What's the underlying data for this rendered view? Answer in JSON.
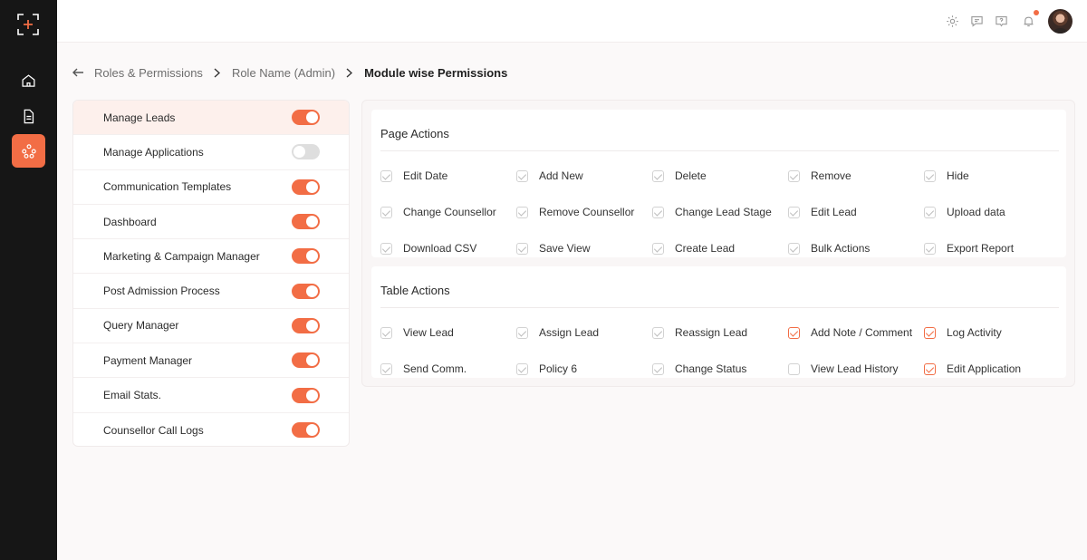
{
  "breadcrumb": {
    "items": [
      "Roles & Permissions",
      "Role Name (Admin)"
    ],
    "current": "Module wise Permissions"
  },
  "modules": [
    {
      "label": "Manage Leads",
      "enabled": true,
      "active": true
    },
    {
      "label": "Manage Applications",
      "enabled": false
    },
    {
      "label": "Communication Templates",
      "enabled": true
    },
    {
      "label": "Dashboard",
      "enabled": true
    },
    {
      "label": "Marketing & Campaign Manager",
      "enabled": true
    },
    {
      "label": "Post Admission Process",
      "enabled": true
    },
    {
      "label": "Query Manager",
      "enabled": true
    },
    {
      "label": "Payment Manager",
      "enabled": true
    },
    {
      "label": "Email Stats.",
      "enabled": true
    },
    {
      "label": "Counsellor Call Logs",
      "enabled": true
    }
  ],
  "page_actions": {
    "title": "Page Actions",
    "items": [
      {
        "label": "Edit Date",
        "checked": true
      },
      {
        "label": "Add New",
        "checked": true
      },
      {
        "label": "Delete",
        "checked": true
      },
      {
        "label": "Remove",
        "checked": true
      },
      {
        "label": "Hide",
        "checked": true
      },
      {
        "label": "Change Counsellor",
        "checked": true
      },
      {
        "label": "Remove Counsellor",
        "checked": true
      },
      {
        "label": "Change Lead Stage",
        "checked": true
      },
      {
        "label": "Edit Lead",
        "checked": true
      },
      {
        "label": "Upload data",
        "checked": true
      },
      {
        "label": "Download CSV",
        "checked": true
      },
      {
        "label": "Save View",
        "checked": true
      },
      {
        "label": "Create Lead",
        "checked": true
      },
      {
        "label": "Bulk Actions",
        "checked": true
      },
      {
        "label": "Export Report",
        "checked": true
      }
    ]
  },
  "table_actions": {
    "title": "Table Actions",
    "items": [
      {
        "label": "View Lead",
        "checked": true
      },
      {
        "label": "Assign Lead",
        "checked": true
      },
      {
        "label": "Reassign Lead",
        "checked": true
      },
      {
        "label": "Add Note / Comment",
        "checked": true,
        "accent": true
      },
      {
        "label": "Log Activity",
        "checked": true,
        "accent": true
      },
      {
        "label": "Send Comm.",
        "checked": true
      },
      {
        "label": "Policy 6",
        "checked": true
      },
      {
        "label": "Change Status",
        "checked": true
      },
      {
        "label": "View Lead History",
        "checked": false
      },
      {
        "label": "Edit Application",
        "checked": true,
        "accent": true
      }
    ]
  },
  "colors": {
    "accent": "#f26d45",
    "sidebar": "#161616"
  },
  "icons": {
    "sidebar": [
      "logo-icon",
      "home-icon",
      "document-icon",
      "network-icon"
    ],
    "topbar": [
      "settings-icon",
      "chat-icon",
      "help-icon",
      "bell-icon"
    ]
  }
}
